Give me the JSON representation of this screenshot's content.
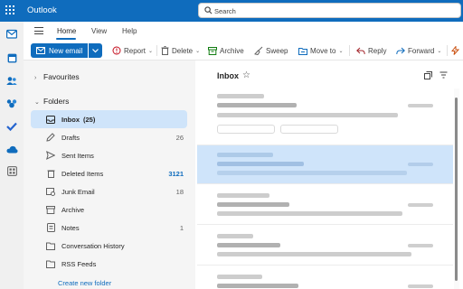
{
  "app": {
    "title": "Outlook"
  },
  "search": {
    "placeholder": "Search"
  },
  "ribbon": {
    "tabs": [
      {
        "label": "Home",
        "active": true
      },
      {
        "label": "View",
        "active": false
      },
      {
        "label": "Help",
        "active": false
      }
    ]
  },
  "toolbar": {
    "new_mail": "New email",
    "report": "Report",
    "delete": "Delete",
    "archive": "Archive",
    "sweep": "Sweep",
    "move_to": "Move to",
    "reply": "Reply",
    "forward": "Forward"
  },
  "folder_pane": {
    "favourites": "Favourites",
    "folders_header": "Folders",
    "folders": [
      {
        "name": "Inbox",
        "count": "(25)",
        "selected": true,
        "icon": "inbox-icon"
      },
      {
        "name": "Drafts",
        "count": "26",
        "icon": "drafts-icon"
      },
      {
        "name": "Sent Items",
        "count": "",
        "icon": "sent-icon"
      },
      {
        "name": "Deleted Items",
        "count": "3121",
        "count_style": "unread",
        "icon": "trash-icon"
      },
      {
        "name": "Junk Email",
        "count": "18",
        "icon": "junk-icon"
      },
      {
        "name": "Archive",
        "count": "",
        "icon": "archive-icon"
      },
      {
        "name": "Notes",
        "count": "1",
        "icon": "notes-icon"
      },
      {
        "name": "Conversation History",
        "count": "",
        "icon": "folder-icon"
      },
      {
        "name": "RSS Feeds",
        "count": "",
        "icon": "folder-icon"
      }
    ],
    "create_new_folder": "Create new folder"
  },
  "message_list": {
    "title": "Inbox"
  },
  "colors": {
    "brand": "#0f6cbd",
    "selected": "#cfe4fa",
    "rail": "#f0f0f0",
    "folder_pane": "#f5f5f5"
  },
  "rail_icons": [
    "mail-icon",
    "calendar-icon",
    "people-icon",
    "groups-icon",
    "todo-icon",
    "onedrive-icon",
    "apps-icon"
  ]
}
